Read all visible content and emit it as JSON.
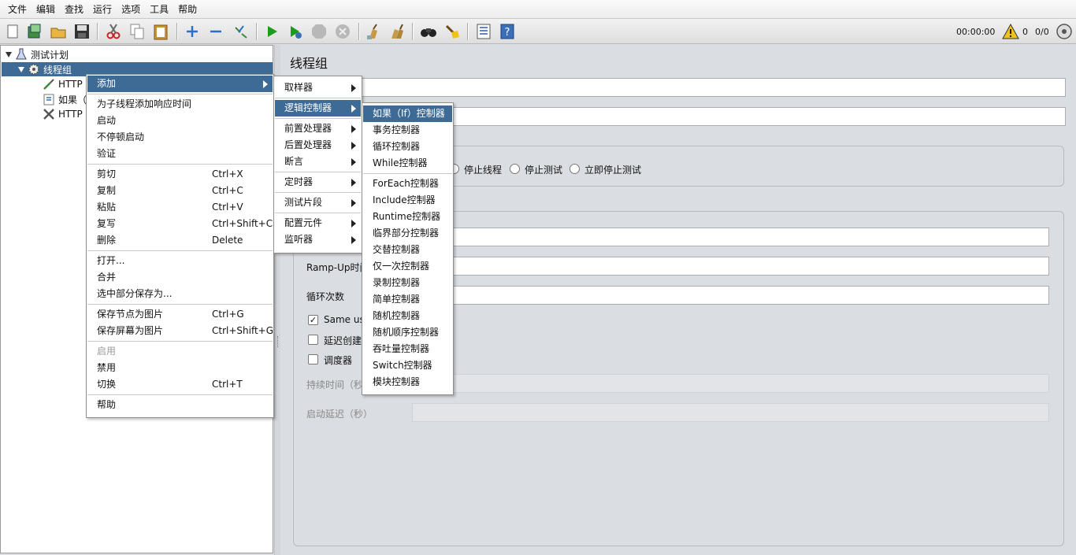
{
  "menubar": [
    "文件",
    "编辑",
    "查找",
    "运行",
    "选项",
    "工具",
    "帮助"
  ],
  "toolbar": {
    "icons": [
      "new-icon",
      "templates-icon",
      "open-icon",
      "save-icon",
      "cut-icon",
      "copy-icon",
      "paste-icon",
      "expand-icon",
      "collapse-icon",
      "toggle-icon",
      "start-icon",
      "start-no-pause-icon",
      "stop-icon",
      "shutdown-icon",
      "clear-icon",
      "clear-all-icon",
      "search-icon",
      "reset-search-icon",
      "function-helper-icon",
      "help-icon"
    ],
    "timer": "00:00:00",
    "warnings": "0",
    "threads": "0/0"
  },
  "tree": {
    "root": "测试计划",
    "thread_group": "线程组",
    "children": [
      "HTTP",
      "如果（",
      "HTTP"
    ]
  },
  "right": {
    "title": "线程组",
    "action_options": [
      "停止线程",
      "停止测试",
      "立即停止测试"
    ],
    "rampup_label": "Ramp-Up时间",
    "loop_label": "循环次数",
    "same_user_label": "Same us",
    "delay_create_label": "延迟创建",
    "scheduler_label": "调度器",
    "duration_label": "持续时间（秒",
    "startup_delay_label": "启动延迟（秒）"
  },
  "context_menu": {
    "items": [
      {
        "label": "添加",
        "submenu": true,
        "highlight": true
      },
      {
        "sep": true
      },
      {
        "label": "为子线程添加响应时间"
      },
      {
        "label": "启动"
      },
      {
        "label": "不停顿启动"
      },
      {
        "label": "验证"
      },
      {
        "sep": true
      },
      {
        "label": "剪切",
        "shortcut": "Ctrl+X"
      },
      {
        "label": "复制",
        "shortcut": "Ctrl+C"
      },
      {
        "label": "粘贴",
        "shortcut": "Ctrl+V"
      },
      {
        "label": "复写",
        "shortcut": "Ctrl+Shift+C"
      },
      {
        "label": "删除",
        "shortcut": "Delete"
      },
      {
        "sep": true
      },
      {
        "label": "打开..."
      },
      {
        "label": "合并"
      },
      {
        "label": "选中部分保存为..."
      },
      {
        "sep": true
      },
      {
        "label": "保存节点为图片",
        "shortcut": "Ctrl+G"
      },
      {
        "label": "保存屏幕为图片",
        "shortcut": "Ctrl+Shift+G"
      },
      {
        "sep": true
      },
      {
        "label": "启用",
        "disabled": true
      },
      {
        "label": "禁用"
      },
      {
        "label": "切换",
        "shortcut": "Ctrl+T"
      },
      {
        "sep": true
      },
      {
        "label": "帮助"
      }
    ]
  },
  "add_submenu": {
    "items": [
      {
        "label": "取样器",
        "submenu": true
      },
      {
        "sep": true
      },
      {
        "label": "逻辑控制器",
        "submenu": true,
        "highlight": true
      },
      {
        "sep": true
      },
      {
        "label": "前置处理器",
        "submenu": true
      },
      {
        "label": "后置处理器",
        "submenu": true
      },
      {
        "label": "断言",
        "submenu": true
      },
      {
        "sep": true
      },
      {
        "label": "定时器",
        "submenu": true
      },
      {
        "sep": true
      },
      {
        "label": "测试片段",
        "submenu": true
      },
      {
        "sep": true
      },
      {
        "label": "配置元件",
        "submenu": true
      },
      {
        "label": "监听器",
        "submenu": true
      }
    ]
  },
  "logic_submenu": {
    "items": [
      {
        "label": "如果（If）控制器",
        "highlight": true
      },
      {
        "label": "事务控制器"
      },
      {
        "label": "循环控制器"
      },
      {
        "label": "While控制器"
      },
      {
        "sep": true
      },
      {
        "label": "ForEach控制器"
      },
      {
        "label": "Include控制器"
      },
      {
        "label": "Runtime控制器"
      },
      {
        "label": "临界部分控制器"
      },
      {
        "label": "交替控制器"
      },
      {
        "label": "仅一次控制器"
      },
      {
        "label": "录制控制器"
      },
      {
        "label": "简单控制器"
      },
      {
        "label": "随机控制器"
      },
      {
        "label": "随机顺序控制器"
      },
      {
        "label": "吞吐量控制器"
      },
      {
        "label": "Switch控制器"
      },
      {
        "label": "模块控制器"
      }
    ]
  }
}
